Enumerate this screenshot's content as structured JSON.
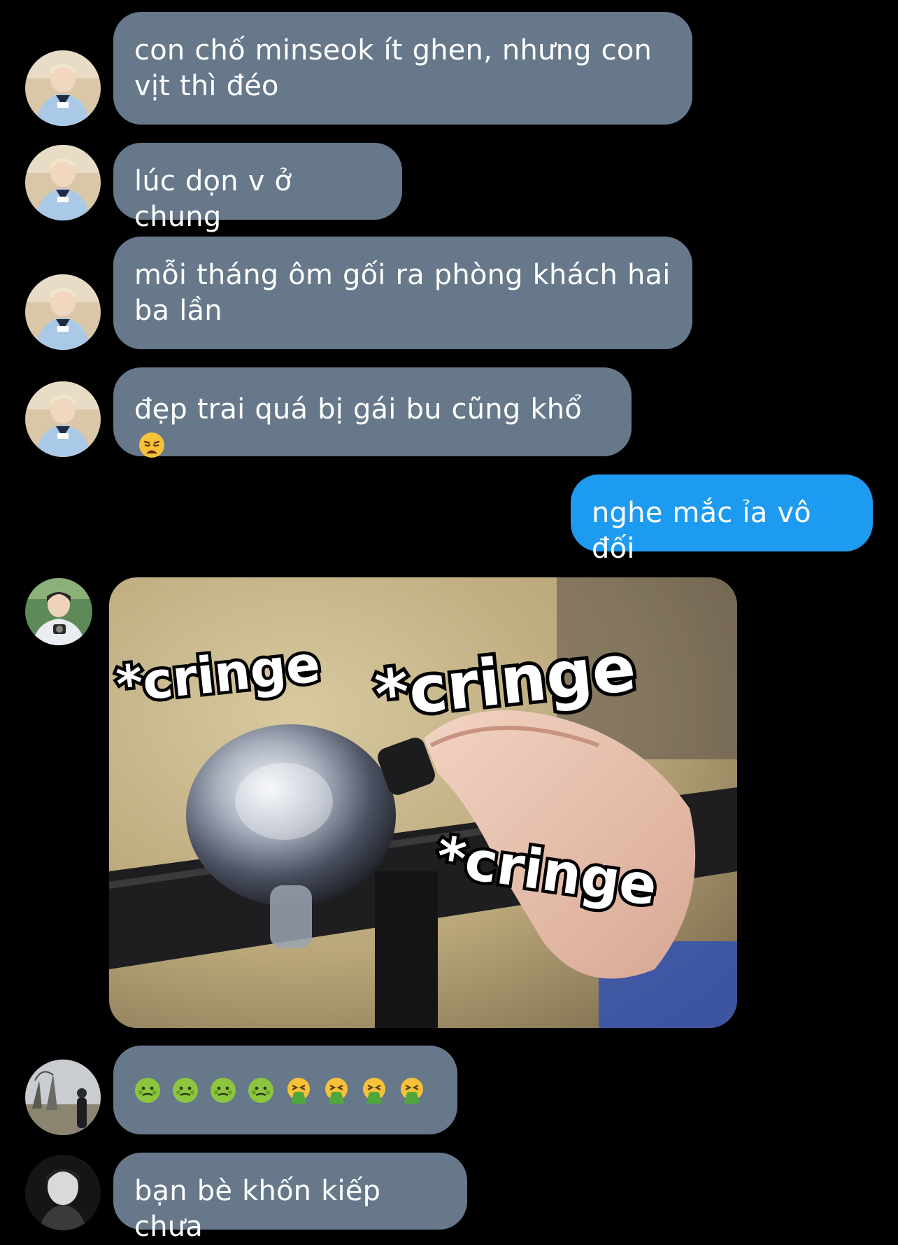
{
  "conversation": {
    "messages": [
      {
        "sender": "other",
        "text": "con chố minseok ít ghen, nhưng con vịt thì đéo"
      },
      {
        "sender": "other",
        "text": "lúc dọn v ở chung"
      },
      {
        "sender": "other",
        "text": "mỗi tháng ôm gối ra phòng khách hai ba lần"
      },
      {
        "sender": "other",
        "text": "đẹp trai quá bị gái bu cũng khổ",
        "emoji": "weary-face"
      },
      {
        "sender": "me",
        "text": "nghe mắc ỉa vô đối"
      },
      {
        "sender": "other2",
        "type": "image",
        "image": {
          "subject": "bicycle-bell-meme",
          "captions": [
            "*cringe",
            "*cringe",
            "*cringe"
          ]
        }
      },
      {
        "sender": "other3",
        "type": "emoji",
        "emojis": [
          "nauseated-face",
          "nauseated-face",
          "nauseated-face",
          "nauseated-face",
          "vomiting-face",
          "vomiting-face",
          "vomiting-face",
          "vomiting-face"
        ]
      },
      {
        "sender": "other4",
        "text": "bạn bè khốn kiếp chưa"
      }
    ]
  },
  "colors": {
    "background": "#000000",
    "incoming_bubble": "#66788a",
    "outgoing_bubble": "#1d9bf0",
    "text": "#ffffff"
  }
}
